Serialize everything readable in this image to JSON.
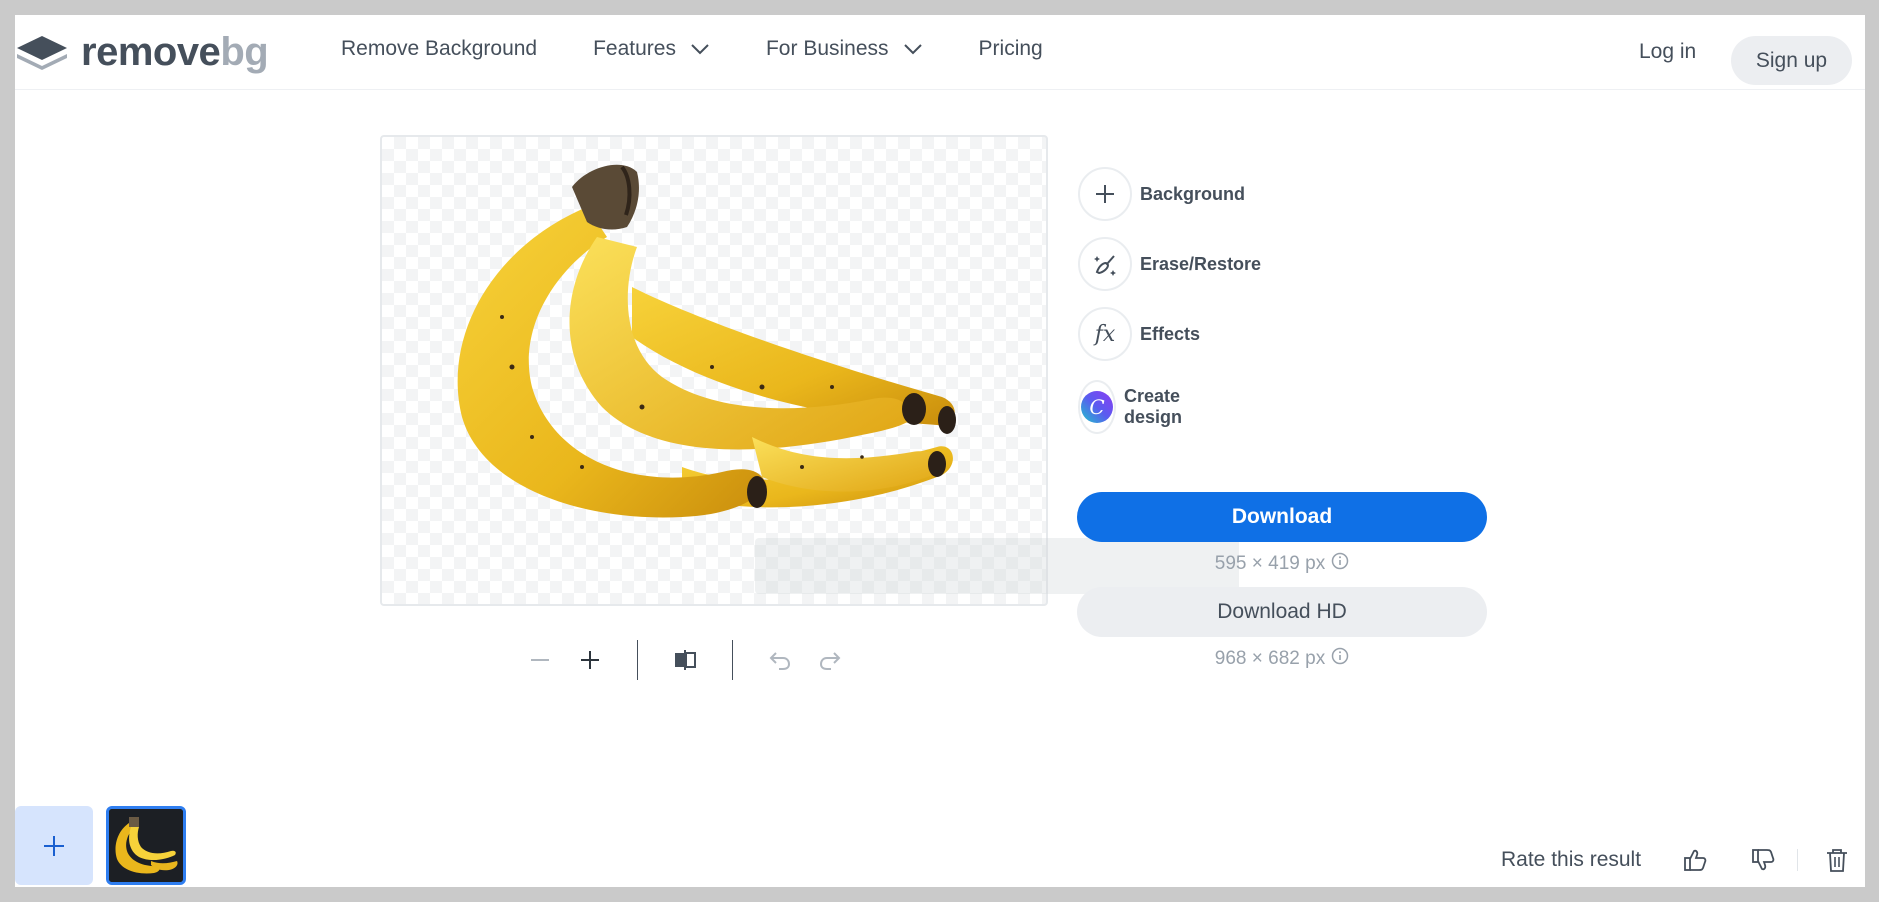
{
  "brand": {
    "name_part1": "remove",
    "name_part2": "bg",
    "logo_color": "#454f5b",
    "logo_accent": "#a3abb5"
  },
  "nav": {
    "items": [
      {
        "label": "Remove Background",
        "has_dropdown": false
      },
      {
        "label": "Features",
        "has_dropdown": true
      },
      {
        "label": "For Business",
        "has_dropdown": true
      },
      {
        "label": "Pricing",
        "has_dropdown": false
      }
    ],
    "login_label": "Log in",
    "signup_label": "Sign up"
  },
  "tools": [
    {
      "label": "Background",
      "icon": "plus-icon"
    },
    {
      "label": "Erase/Restore",
      "icon": "magic-brush-icon"
    },
    {
      "label": "Effects",
      "icon": "fx-icon",
      "glyph": "fx"
    },
    {
      "label": "Create design",
      "icon": "canva-icon",
      "glyph": "C"
    }
  ],
  "download": {
    "label": "Download",
    "size": "595 × 419 px",
    "hd_label": "Download HD",
    "hd_size": "968 × 682 px"
  },
  "toolbar": {
    "icons": [
      "zoom-out-icon",
      "zoom-in-icon",
      "compare-icon",
      "undo-icon",
      "redo-icon"
    ]
  },
  "footer": {
    "rate_label": "Rate this result"
  },
  "colors": {
    "primary": "#0f70e6",
    "text": "#454f5b",
    "muted": "#98a1ab",
    "add_tile": "#d6e4fd",
    "thumb_border": "#2f7ef0"
  }
}
